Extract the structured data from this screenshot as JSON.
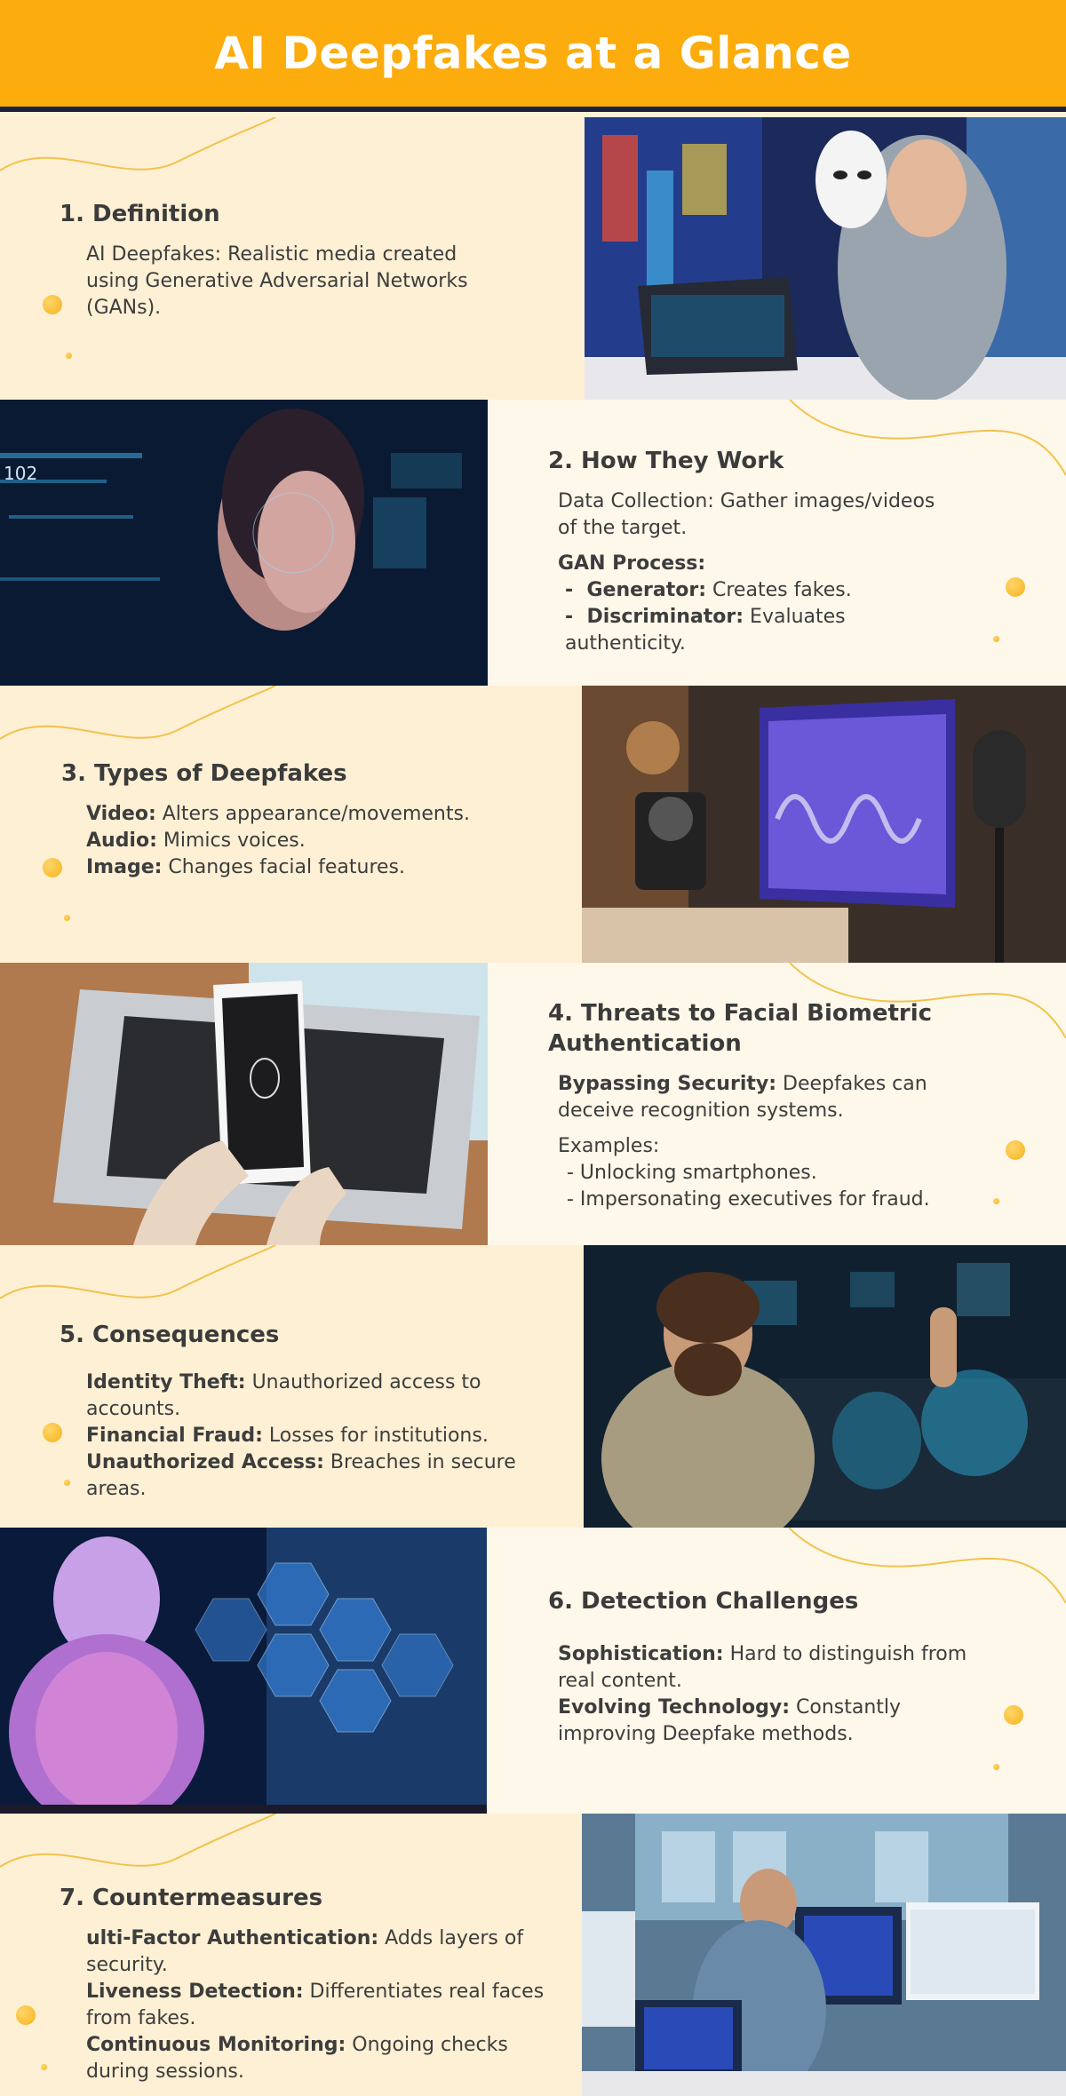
{
  "header": {
    "title": "AI Deepfakes at a Glance"
  },
  "colors": {
    "header": "#fcac0c",
    "header_border": "#1d2238",
    "panel_light": "#fef0d4",
    "panel_lighter": "#fef8ea",
    "accent_dot": "#f5b21b"
  },
  "sections": [
    {
      "title": "1. Definition",
      "body": "AI Deepfakes: Realistic media created using Generative Adversarial Networks (GANs).",
      "image": "person-holding-white-mask-with-laptop"
    },
    {
      "title": "2. How They Work",
      "data_collection": "Data Collection: Gather images/videos of the target.",
      "gan_label": "GAN Process:",
      "generator_label": "Generator:",
      "generator_text": " Creates fakes.",
      "discriminator_label": "Discriminator:",
      "discriminator_text": " Evaluates authenticity.",
      "bullet": "-",
      "image": "face-with-digital-hud-overlay"
    },
    {
      "title": "3. Types of Deepfakes",
      "items": [
        {
          "label": "Video:",
          "text": " Alters appearance/movements."
        },
        {
          "label": "Audio:",
          "text": " Mimics voices."
        },
        {
          "label": "Image:",
          "text": " Changes facial features."
        }
      ],
      "image": "studio-microphone-and-audio-waveform-monitor"
    },
    {
      "title": "4. Threats to Facial Biometric Authentication",
      "bypass_label": "Bypassing Security:",
      "bypass_text": " Deepfakes can deceive recognition systems.",
      "examples_label": "Examples:",
      "examples": [
        "- Unlocking smartphones.",
        "- Impersonating executives for fraud."
      ],
      "image": "smartphone-fingerprint-scan-over-laptop"
    },
    {
      "title": "5. Consequences",
      "items": [
        {
          "label": "Identity Theft:",
          "text": " Unauthorized access to accounts."
        },
        {
          "label": "Financial Fraud:",
          "text": " Losses for institutions."
        },
        {
          "label": "Unauthorized Access:",
          "text": " Breaches in secure areas."
        }
      ],
      "image": "man-gesturing-with-holographic-screens"
    },
    {
      "title": "6. Detection Challenges",
      "items": [
        {
          "label": "Sophistication:",
          "text": " Hard to distinguish from real content."
        },
        {
          "label": "Evolving Technology:",
          "text": " Constantly improving Deepfake methods."
        }
      ],
      "image": "robot-with-hexagon-interface"
    },
    {
      "title": "7. Countermeasures",
      "items": [
        {
          "label": "ulti-Factor Authentication:",
          "text": " Adds layers of security."
        },
        {
          "label": "Liveness Detection:",
          "text": " Differentiates real faces from fakes."
        },
        {
          "label": "Continuous Monitoring:",
          "text": " Ongoing checks during sessions."
        }
      ],
      "image": "analyst-at-monitors-with-data-visualizations"
    }
  ]
}
